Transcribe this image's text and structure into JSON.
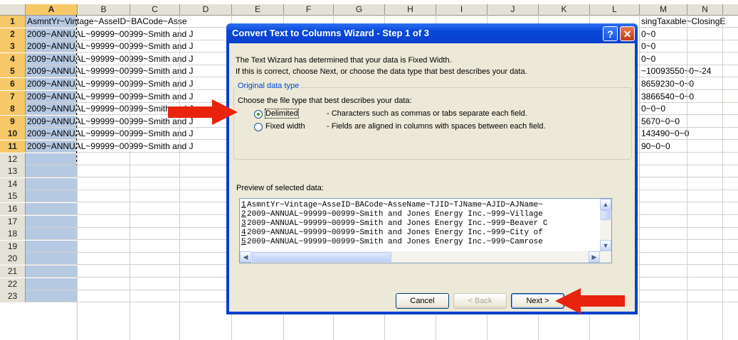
{
  "spreadsheet": {
    "columns": [
      "A",
      "B",
      "C",
      "D",
      "E",
      "F",
      "G",
      "H",
      "I",
      "J",
      "K",
      "L",
      "M",
      "N"
    ],
    "selected_column": "A",
    "rows": [
      "1",
      "2",
      "3",
      "4",
      "5",
      "6",
      "7",
      "8",
      "9",
      "10",
      "11",
      "12",
      "13",
      "14",
      "15",
      "16",
      "17",
      "18",
      "19",
      "20",
      "21",
      "22",
      "23"
    ],
    "cells_left": [
      "AsmntYr~Vintage~AsseID~BACode~Asse",
      "2009~ANNUAL~99999~00999~Smith and J",
      "2009~ANNUAL~99999~00999~Smith and J",
      "2009~ANNUAL~99999~00999~Smith and J",
      "2009~ANNUAL~99999~00999~Smith and J",
      "2009~ANNUAL~99999~00999~Smith and J",
      "2009~ANNUAL~99999~00999~Smith and J",
      "2009~ANNUAL~99999~00999~Smith and J",
      "2009~ANNUAL~99999~00999~Smith and J",
      "2009~ANNUAL~99999~00999~Smith and J",
      "2009~ANNUAL~99999~00999~Smith and J"
    ],
    "cells_right": [
      "singTaxable~ClosingE",
      "0~0",
      "0~0",
      "0~0",
      "~10093550~0~-24",
      "8659230~0~0",
      "3866540~0~0",
      "0~0~0",
      "5670~0~0",
      "143490~0~0",
      "90~0~0"
    ]
  },
  "dialog": {
    "title": "Convert Text to Columns Wizard - Step 1 of 3",
    "help_label": "?",
    "close_label": "✕",
    "intro_line1": "The Text Wizard has determined that your data is Fixed Width.",
    "intro_line2": "If this is correct, choose Next, or choose the data type that best describes your data.",
    "group_label": "Original data type",
    "group_prompt": "Choose the file type that best describes your data:",
    "options": [
      {
        "label": "Delimited",
        "desc": "- Characters such as commas or tabs separate each field.",
        "selected": true
      },
      {
        "label": "Fixed width",
        "desc": "- Fields are aligned in columns with spaces between each field.",
        "selected": false
      }
    ],
    "preview_label": "Preview of selected data:",
    "preview_lines": [
      {
        "num": "1",
        "text": "AsmntYr~Vintage~AsseID~BACode~AsseName~TJID~TJName~AJID~AJName~"
      },
      {
        "num": "2",
        "text": "2009~ANNUAL~99999~00999~Smith and Jones Energy Inc.~999~Village"
      },
      {
        "num": "3",
        "text": "2009~ANNUAL~99999~00999~Smith and Jones Energy Inc.~999~Beaver C"
      },
      {
        "num": "4",
        "text": "2009~ANNUAL~99999~00999~Smith and Jones Energy Inc.~999~City of"
      },
      {
        "num": "5",
        "text": "2009~ANNUAL~99999~00999~Smith and Jones Energy Inc.~999~Camrose"
      }
    ],
    "buttons": {
      "cancel": "Cancel",
      "back": "< Back",
      "next": "Next >"
    }
  },
  "colors": {
    "annotation_arrow": "#e8230e",
    "title_bar": "#0a3fcf",
    "selected_header": "#f7c868",
    "selected_column": "#b6c9e3"
  }
}
